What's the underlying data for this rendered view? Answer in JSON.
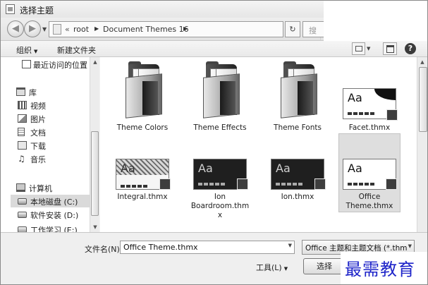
{
  "window": {
    "title": "选择主题"
  },
  "address_bar": {
    "chevron": "«",
    "crumbs": [
      "root",
      "Document Themes 16"
    ],
    "refresh_glyph": "↻"
  },
  "search": {
    "placeholder": "搜"
  },
  "toolbar": {
    "organize_label": "组织",
    "new_folder_label": "新建文件夹",
    "help_glyph": "?"
  },
  "sidebar": {
    "items": [
      {
        "label": "最近访问的位置",
        "icon": "recent-places-icon",
        "level": "top"
      },
      {
        "label": "库",
        "icon": "library-icon",
        "level": "group"
      },
      {
        "label": "视频",
        "icon": "video-icon",
        "level": "child"
      },
      {
        "label": "图片",
        "icon": "picture-icon",
        "level": "child"
      },
      {
        "label": "文档",
        "icon": "document-icon",
        "level": "child"
      },
      {
        "label": "下载",
        "icon": "download-icon",
        "level": "child"
      },
      {
        "label": "音乐",
        "icon": "music-icon",
        "level": "child"
      },
      {
        "label": "计算机",
        "icon": "computer-icon",
        "level": "group"
      },
      {
        "label": "本地磁盘 (C:)",
        "icon": "drive-icon",
        "level": "child",
        "selected": true
      },
      {
        "label": "软件安装 (D:)",
        "icon": "drive-icon",
        "level": "child"
      },
      {
        "label": "工作学习 (E:)",
        "icon": "drive-icon",
        "level": "child"
      }
    ]
  },
  "files": {
    "items": [
      {
        "name": "Theme Colors",
        "kind": "folder"
      },
      {
        "name": "Theme Effects",
        "kind": "folder"
      },
      {
        "name": "Theme Fonts",
        "kind": "folder"
      },
      {
        "name": "Facet.thmx",
        "kind": "theme",
        "style": "white-corner",
        "preview_text": "Aa"
      },
      {
        "name": "Integral.thmx",
        "kind": "theme",
        "style": "pattern",
        "preview_text": "Aa"
      },
      {
        "name": "Ion Boardroom.thmx",
        "kind": "theme",
        "style": "dark",
        "preview_text": "Aa"
      },
      {
        "name": "Ion.thmx",
        "kind": "theme",
        "style": "dark",
        "preview_text": "Aa"
      },
      {
        "name": "Office Theme.thmx",
        "kind": "theme",
        "style": "white",
        "preview_text": "Aa",
        "selected": true
      }
    ],
    "badge_glyph": "P"
  },
  "bottom": {
    "filename_label": "文件名(N):",
    "filename_value": "Office Theme.thmx",
    "filetype_value": "Office 主题和主题文档 (*.thmx",
    "tools_label": "工具(L)",
    "select_label": "选择"
  },
  "watermark": {
    "text": "最需教育"
  },
  "colors": {
    "watermark": "#1e24c9",
    "selection": "#dedede"
  }
}
